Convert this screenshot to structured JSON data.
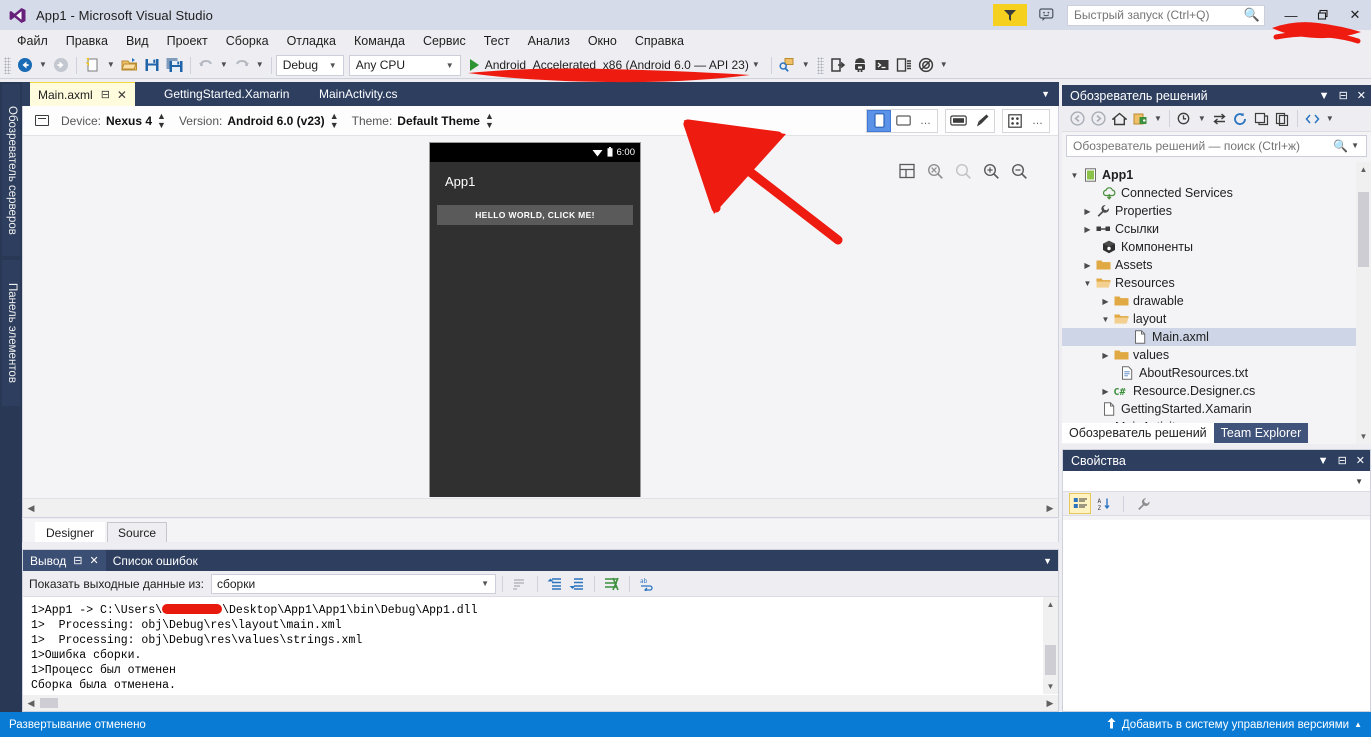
{
  "window": {
    "title": "App1 - Microsoft Visual Studio",
    "logo_icon": "visual-studio-logo",
    "notification_icon": "notification-flag-icon",
    "feedback_icon": "feedback-smiley-icon",
    "minimize_label": "—",
    "maximize_label": "❐",
    "close_label": "✕"
  },
  "quick_launch": {
    "placeholder": "Быстрый запуск (Ctrl+Q)",
    "value": "",
    "icon": "search-icon"
  },
  "menu": {
    "items": [
      {
        "label": "Файл"
      },
      {
        "label": "Правка"
      },
      {
        "label": "Вид"
      },
      {
        "label": "Проект"
      },
      {
        "label": "Сборка"
      },
      {
        "label": "Отладка"
      },
      {
        "label": "Команда"
      },
      {
        "label": "Сервис"
      },
      {
        "label": "Тест"
      },
      {
        "label": "Анализ"
      },
      {
        "label": "Окно"
      },
      {
        "label": "Справка"
      }
    ]
  },
  "toolbar": {
    "navigate_back_icon": "navigate-back-icon",
    "navigate_forward_icon": "navigate-forward-icon",
    "new_project_icon": "new-project-icon",
    "open_file_icon": "open-file-icon",
    "save_icon": "save-icon",
    "save_all_icon": "save-all-icon",
    "undo_icon": "undo-icon",
    "redo_icon": "redo-icon",
    "configuration": "Debug",
    "platform": "Any CPU",
    "start_label": "Android_Accelerated_x86 (Android 6.0 — API 23)",
    "start_icon": "play-icon",
    "android_tools": [
      {
        "icon": "android-sdk-manager-icon"
      },
      {
        "icon": "device-deploy-icon"
      },
      {
        "icon": "android-avd-manager-icon"
      },
      {
        "icon": "adb-console-icon"
      },
      {
        "icon": "device-log-icon"
      },
      {
        "icon": "android-device-monitor-icon"
      }
    ]
  },
  "left_dock": {
    "tabs": [
      {
        "label": "Обозреватель серверов"
      },
      {
        "label": "Панель элементов"
      }
    ]
  },
  "editor_tabs": [
    {
      "label": "Main.axml",
      "active": true,
      "pin_icon": "pin-icon",
      "close_icon": "close-icon"
    },
    {
      "label": "GettingStarted.Xamarin",
      "active": false
    },
    {
      "label": "MainActivity.cs",
      "active": false
    }
  ],
  "designer": {
    "device_icon": "device-icon",
    "device_label": "Device:",
    "device_value": "Nexus 4",
    "version_label": "Version:",
    "version_value": "Android 6.0 (v23)",
    "theme_label": "Theme:",
    "theme_value": "Default Theme",
    "view_buttons": [
      {
        "icon": "portrait-view-icon",
        "selected": true
      },
      {
        "icon": "landscape-view-icon",
        "selected": false
      },
      {
        "icon": "more-views-icon",
        "selected": false
      }
    ],
    "tool_buttons": [
      {
        "icon": "device-frame-icon"
      },
      {
        "icon": "theme-brush-icon"
      }
    ],
    "grid_buttons": [
      {
        "icon": "grid-icon"
      },
      {
        "icon": "more-options-icon"
      }
    ],
    "zoom_buttons": [
      {
        "icon": "fit-to-window-icon"
      },
      {
        "icon": "zoom-actual-size-icon"
      },
      {
        "icon": "zoom-reset-icon"
      },
      {
        "icon": "zoom-in-icon"
      },
      {
        "icon": "zoom-out-icon"
      }
    ],
    "preview": {
      "status_time": "6:00",
      "wifi_icon": "wifi-icon",
      "battery_icon": "battery-icon",
      "app_title": "App1",
      "button_text": "HELLO WORLD, CLICK ME!"
    },
    "bottom_tabs": [
      {
        "label": "Designer",
        "selected": true
      },
      {
        "label": "Source",
        "selected": false
      }
    ]
  },
  "output": {
    "tabs": [
      {
        "label": "Вывод",
        "active": true,
        "pin_icon": "pin-icon",
        "close_icon": "close-icon"
      },
      {
        "label": "Список ошибок",
        "active": false
      }
    ],
    "source_label": "Показать выходные данные из:",
    "source_value": "сборки",
    "toolbar_icons": [
      {
        "icon": "find-message-icon"
      },
      {
        "icon": "go-to-previous-message-icon"
      },
      {
        "icon": "go-to-next-message-icon"
      },
      {
        "icon": "clear-all-icon"
      },
      {
        "icon": "toggle-word-wrap-icon"
      }
    ],
    "lines": [
      {
        "pre": "1>App1 -> C:\\Users\\",
        "redacted": true,
        "post": "\\Desktop\\App1\\App1\\bin\\Debug\\App1.dll"
      },
      {
        "pre": "1>  Processing: obj\\Debug\\res\\layout\\main.xml",
        "redacted": false,
        "post": ""
      },
      {
        "pre": "1>  Processing: obj\\Debug\\res\\values\\strings.xml",
        "redacted": false,
        "post": ""
      },
      {
        "pre": "1>Ошибка сборки.",
        "redacted": false,
        "post": ""
      },
      {
        "pre": "1>Процесс был отменен",
        "redacted": false,
        "post": ""
      },
      {
        "pre": "Сборка была отменена.",
        "redacted": false,
        "post": ""
      }
    ]
  },
  "solution_explorer": {
    "title": "Обозреватель решений",
    "dropdown_icon": "chevron-down-icon",
    "pin_icon": "pin-icon",
    "close_icon": "close-icon",
    "toolbar_icons": [
      {
        "icon": "back-icon"
      },
      {
        "icon": "forward-icon"
      },
      {
        "icon": "home-icon"
      },
      {
        "icon": "pending-changes-icon"
      },
      {
        "icon": "chevron-down-icon"
      },
      {
        "icon": "show-all-files-icon"
      },
      {
        "icon": "sync-with-active-document-icon"
      },
      {
        "icon": "refresh-icon"
      },
      {
        "icon": "collapse-all-icon"
      },
      {
        "icon": "properties-icon"
      },
      {
        "icon": "view-code-icon"
      }
    ],
    "search_placeholder": "Обозреватель решений — поиск (Ctrl+ж)",
    "search_value": "",
    "search_icon": "search-icon",
    "tree": [
      {
        "label": "App1",
        "indent": 0,
        "twisty": "expanded",
        "icon": "android-project-icon",
        "bold": true,
        "selected": false
      },
      {
        "label": "Connected Services",
        "indent": 1,
        "twisty": "none",
        "icon": "connected-services-icon",
        "bold": false,
        "selected": false
      },
      {
        "label": "Properties",
        "indent": 1,
        "twisty": "collapsed",
        "icon": "wrench-icon",
        "bold": false,
        "selected": false
      },
      {
        "label": "Ссылки",
        "indent": 1,
        "twisty": "collapsed",
        "icon": "references-icon",
        "bold": false,
        "selected": false
      },
      {
        "label": "Компоненты",
        "indent": 1,
        "twisty": "none",
        "icon": "components-box-icon",
        "bold": false,
        "selected": false
      },
      {
        "label": "Assets",
        "indent": 1,
        "twisty": "collapsed",
        "icon": "folder-icon",
        "bold": false,
        "selected": false
      },
      {
        "label": "Resources",
        "indent": 1,
        "twisty": "expanded",
        "icon": "folder-open-icon",
        "bold": false,
        "selected": false
      },
      {
        "label": "drawable",
        "indent": 2,
        "twisty": "collapsed",
        "icon": "folder-icon",
        "bold": false,
        "selected": false
      },
      {
        "label": "layout",
        "indent": 2,
        "twisty": "expanded",
        "icon": "folder-open-icon",
        "bold": false,
        "selected": false
      },
      {
        "label": "Main.axml",
        "indent": 3,
        "twisty": "none",
        "icon": "file-icon",
        "bold": false,
        "selected": true
      },
      {
        "label": "values",
        "indent": 2,
        "twisty": "collapsed",
        "icon": "folder-icon",
        "bold": false,
        "selected": false
      },
      {
        "label": "AboutResources.txt",
        "indent": 2,
        "twisty": "none",
        "icon": "text-file-icon",
        "bold": false,
        "selected": false
      },
      {
        "label": "Resource.Designer.cs",
        "indent": 2,
        "twisty": "collapsed",
        "icon": "csharp-file-icon",
        "bold": false,
        "selected": false
      },
      {
        "label": "GettingStarted.Xamarin",
        "indent": 1,
        "twisty": "none",
        "icon": "file-icon",
        "bold": false,
        "selected": false
      },
      {
        "label": "MainActivity.cs",
        "indent": 1,
        "twisty": "collapsed",
        "icon": "csharp-file-icon",
        "bold": false,
        "selected": false
      }
    ],
    "bottom_tabs": [
      {
        "label": "Обозреватель решений",
        "selected": true
      },
      {
        "label": "Team Explorer",
        "selected": false
      }
    ]
  },
  "properties": {
    "title": "Свойства",
    "dropdown_icon": "chevron-down-icon",
    "pin_icon": "pin-icon",
    "close_icon": "close-icon",
    "object_value": "",
    "toolbar_icons": [
      {
        "icon": "categorized-icon",
        "selected": true
      },
      {
        "icon": "alphabetical-sort-icon",
        "selected": false
      },
      {
        "icon": "properties-wrench-icon",
        "selected": false
      }
    ]
  },
  "status_bar": {
    "message": "Развертывание отменено",
    "source_control_label": "Добавить в систему управления версиями",
    "source_control_icon": "upload-arrow-icon",
    "expand_icon": "chevron-up-icon",
    "accent_color": "#0a7bd4"
  },
  "annotations": {
    "color": "#ee1b11",
    "items": [
      {
        "name": "underline-start-target",
        "kind": "scribble"
      },
      {
        "name": "scribble-near-titlebar",
        "kind": "scribble"
      },
      {
        "name": "pointer-arrow-to-designer",
        "kind": "arrow"
      },
      {
        "name": "redacted-username",
        "kind": "redaction"
      }
    ]
  }
}
